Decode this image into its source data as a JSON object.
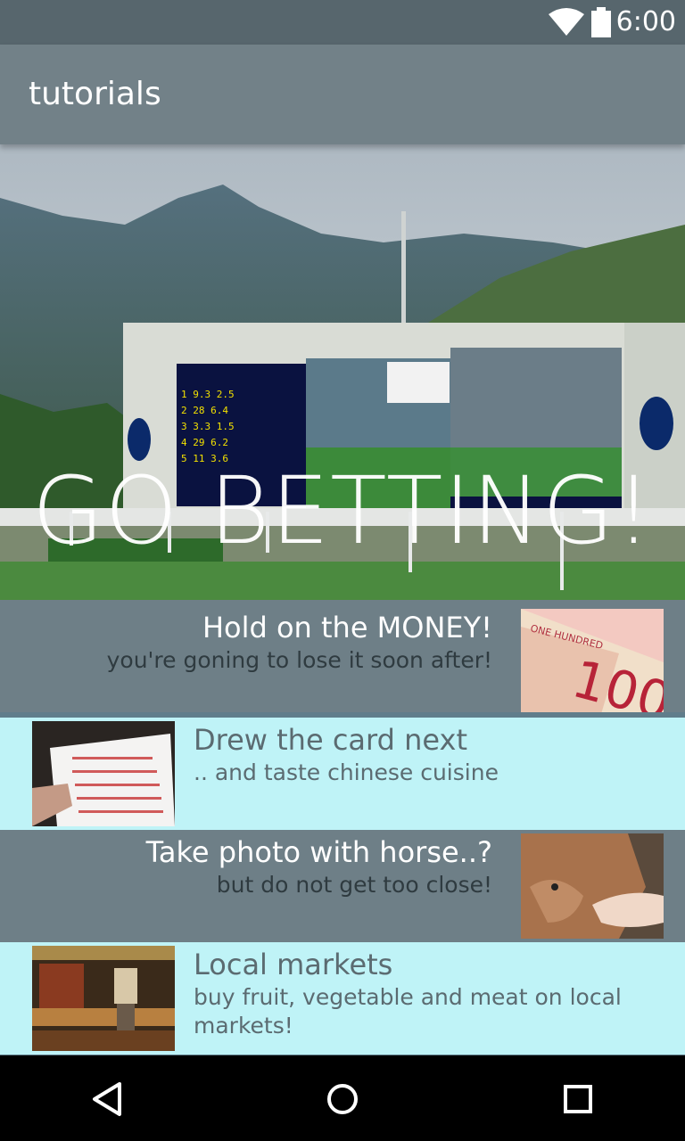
{
  "status_bar": {
    "time": "6:00"
  },
  "app_bar": {
    "title": "tutorials"
  },
  "hero": {
    "title": "GO BETTING!"
  },
  "list": [
    {
      "title": "Hold on the MONEY!",
      "subtitle": "you're goning to lose it soon after!",
      "thumbnail": "banknote-image",
      "style": "gray"
    },
    {
      "title": "Drew the card next",
      "subtitle": ".. and taste chinese cuisine",
      "thumbnail": "betting-slip-image",
      "style": "cyan"
    },
    {
      "title": "Take photo with horse..?",
      "subtitle": "but do not get too close!",
      "thumbnail": "deer-image",
      "style": "gray"
    },
    {
      "title": "Local markets",
      "subtitle": "buy fruit, vegetable and meat on local markets!",
      "thumbnail": "market-image",
      "style": "cyan"
    }
  ],
  "nav": {
    "back": "back-icon",
    "home": "home-icon",
    "recents": "recents-icon"
  },
  "colors": {
    "status_bar": "#57666d",
    "app_bar": "#728188",
    "row_gray": "#6e7f87",
    "row_cyan": "#bff3f7"
  }
}
